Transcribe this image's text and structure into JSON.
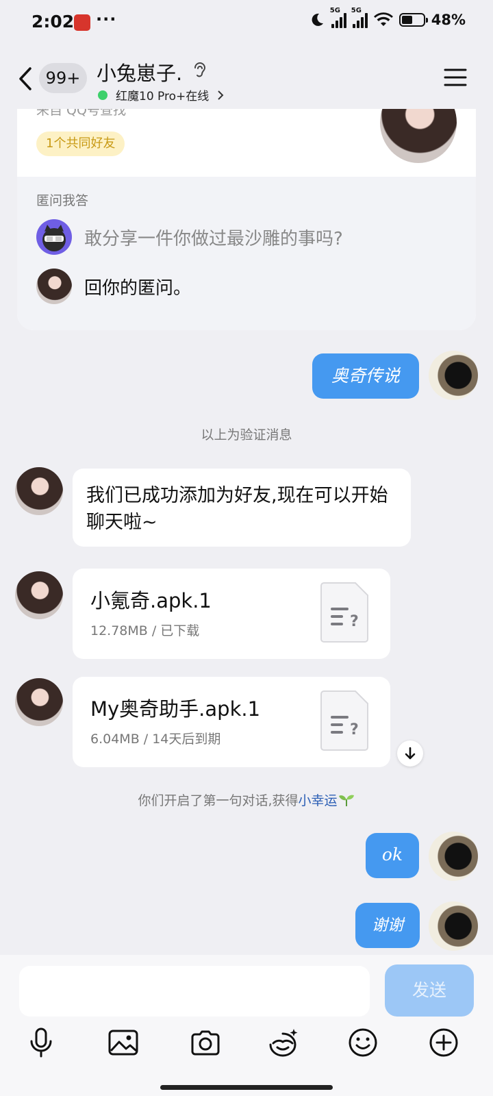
{
  "status_bar": {
    "time": "2:02",
    "dots": "···",
    "network_1": "5G",
    "network_2": "5G",
    "battery": "48%"
  },
  "header": {
    "unread_count": "99+",
    "contact_name": "小兔崽子.",
    "online_status": "红魔10 Pro+在线",
    "online_color": "#3ed06b"
  },
  "profile_card": {
    "source_partial": "来自 QQ号查找",
    "mutual_friends": "1个共同好友",
    "qa_title": "匿问我答",
    "qa_question": "敢分享一件你做过最沙雕的事吗?",
    "qa_answer": "回你的匿问。"
  },
  "messages": {
    "out_1": "奥奇传说",
    "verify_notice": "以上为验证消息",
    "in_text": "我们已成功添加为好友,现在可以开始聊天啦~",
    "file_1": {
      "name": "小氪奇.apk.1",
      "meta": "12.78MB / 已下载"
    },
    "file_2": {
      "name": "My奥奇助手.apk.1",
      "meta": "6.04MB / 14天后到期"
    },
    "first_chat_prefix": "你们开启了第一句对话,获得",
    "first_chat_link": "小幸运",
    "out_2": "ok",
    "out_3": "谢谢"
  },
  "input": {
    "placeholder": "",
    "send_label": "发送"
  },
  "toolbar": [
    "microphone-icon",
    "image-icon",
    "camera-icon",
    "emoticon-face-icon",
    "smiley-icon",
    "plus-icon"
  ],
  "colors": {
    "bubble_out": "#4599f0",
    "send_button": "#9cc7f6",
    "mutual_chip_bg": "#fdf1c5",
    "link": "#2c5fb5"
  }
}
